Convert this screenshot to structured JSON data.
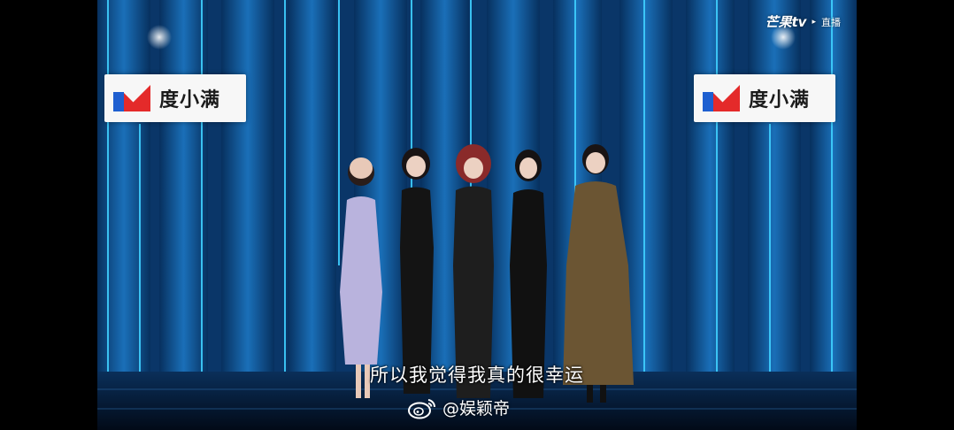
{
  "broadcast": {
    "brand_name": "芒果tv",
    "live_label": "直播",
    "play_glyph": "▸"
  },
  "sponsor": {
    "left_text": "度小满",
    "right_text": "度小满",
    "logo_icon": "du-xiaoman-logo",
    "colors": {
      "red": "#e42a2a",
      "blue": "#1e5fd0"
    }
  },
  "subtitle": {
    "text": "所以我觉得我真的很幸运"
  },
  "watermark": {
    "icon": "weibo-icon",
    "handle": "@娱颖帝"
  },
  "scene": {
    "accent": "#14b4ff"
  }
}
